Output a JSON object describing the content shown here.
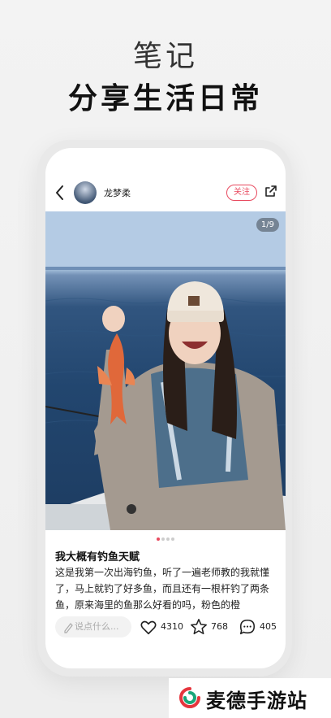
{
  "promo": {
    "line1": "笔记",
    "line2": "分享生活日常"
  },
  "post": {
    "username": "龙梦柔",
    "follow_label": "关注",
    "image_counter": "1/9",
    "carousel_index": 1,
    "carousel_total": 4,
    "title": "我大概有钓鱼天赋",
    "body": "这是我第一次出海钓鱼，听了一遍老师教的我就懂了，马上就钓了好多鱼，而且还有一根杆钓了两条鱼，原来海里的鱼那么好看的吗，粉色的橙"
  },
  "actions": {
    "comment_placeholder": "说点什么...",
    "likes": "4310",
    "favorites": "768",
    "comments": "405"
  },
  "branding": {
    "text": "麦德手游站",
    "colors": {
      "red": "#e6353d",
      "green": "#1aa67a"
    }
  },
  "colors": {
    "accent": "#e84a5f"
  }
}
